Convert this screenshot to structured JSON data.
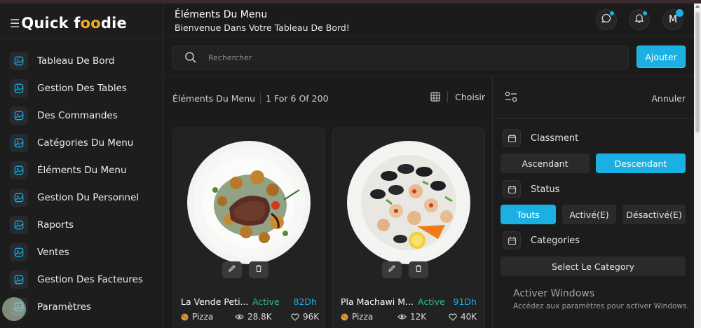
{
  "app": {
    "brand_prefix": "Quick ",
    "brand_f": "f",
    "brand_oo": "oo",
    "brand_suffix": "die"
  },
  "sidebar": {
    "items": [
      {
        "label": "Tableau De Bord"
      },
      {
        "label": "Gestion Des Tables"
      },
      {
        "label": "Des Commandes"
      },
      {
        "label": "Catégories Du Menu"
      },
      {
        "label": "Éléments Du Menu"
      },
      {
        "label": "Gestion Du Personnel"
      },
      {
        "label": "Raports"
      },
      {
        "label": "Ventes"
      },
      {
        "label": "Gestion Des Facteures"
      },
      {
        "label": "Paramètres"
      }
    ]
  },
  "header": {
    "title": "Éléments Du Menu",
    "subtitle": "Bienvenue Dans Votre Tableau De Bord!",
    "avatar_letter": "M"
  },
  "search": {
    "placeholder": "Rechercher",
    "add_label": "Ajouter"
  },
  "list": {
    "title": "Éléments Du Menu",
    "count": "1 For 6 Of 200",
    "choose_label": "Choisir"
  },
  "cards": [
    {
      "name": "La Vende Peti...",
      "status": "Active",
      "price": "82Dh",
      "category": "Pizza",
      "views": "28.8K",
      "likes": "96K"
    },
    {
      "name": "Pla Machawi M...",
      "status": "Active",
      "price": "91Dh",
      "category": "Pizza",
      "views": "12K",
      "likes": "40K"
    }
  ],
  "filter": {
    "cancel_label": "Annuler",
    "sort_label": "Classment",
    "sort_options": [
      "Ascendant",
      "Descendant"
    ],
    "sort_selected": "Descendant",
    "status_label": "Status",
    "status_options": [
      "Touts",
      "Activé(E)",
      "Désactivé(E)"
    ],
    "status_selected": "Touts",
    "categories_label": "Categories",
    "category_select": "Select Le Category"
  },
  "watermark": {
    "line1": "Activer Windows",
    "line2": "Accédez aux paramètres pour activer Windows."
  },
  "colors": {
    "accent": "#1ab0e4",
    "active": "#2dbb8c",
    "logo_accent": "#f2a928"
  }
}
